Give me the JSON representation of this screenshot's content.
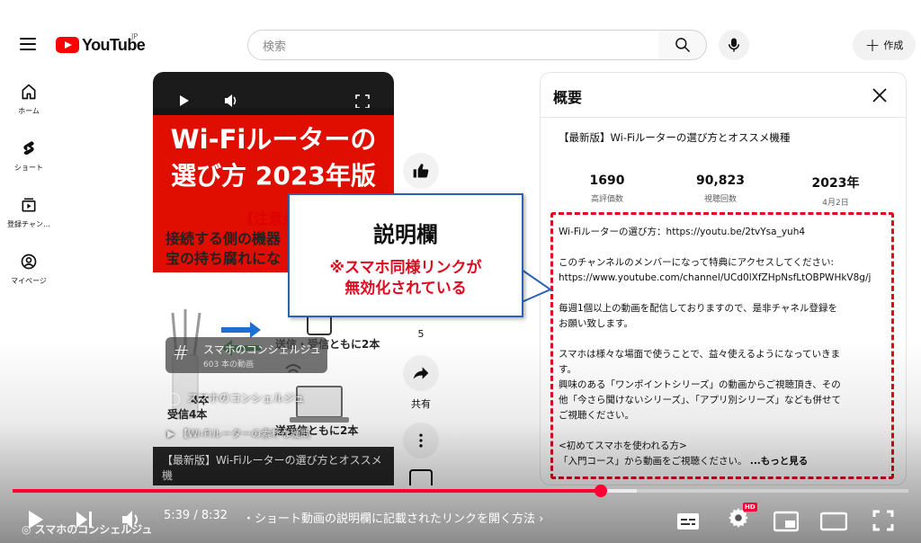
{
  "header": {
    "logo_text": "YouTube",
    "region": "JP",
    "search_placeholder": "検索",
    "create_label": "作成"
  },
  "nav": {
    "items": [
      {
        "label": "ホーム",
        "icon": "home-icon"
      },
      {
        "label": "ショート",
        "icon": "shorts-icon"
      },
      {
        "label": "登録チャン…",
        "icon": "subscriptions-icon"
      },
      {
        "label": "マイページ",
        "icon": "you-icon"
      }
    ]
  },
  "short": {
    "title_line1": "Wi-Fiルーターの",
    "title_line2": "選び方 2023年版",
    "caution": "【注意点",
    "body_line1": "接続する側の機器",
    "body_line2": "宝の持ち腐れにな",
    "diagram_label_top": "送信・受信ともに2本",
    "diagram_label_left1": "4本",
    "diagram_label_left2": "受信4本",
    "diagram_label_bottom": "送受信ともに2本",
    "channel_overlay": "スマホのコンシェルジュ",
    "overlay_link": "【Wi-Fiルーターの素朴な疑問",
    "bottom_title_line1": "【最新版】Wi-Fiルーターの選び方とオススメ機",
    "bottom_title_line2": "種"
  },
  "playlist_chip": {
    "title": "スマホのコンシェルジュ",
    "count": "603 本の動画"
  },
  "rail": {
    "like_count": "5",
    "share_label": "共有"
  },
  "description": {
    "header_title": "概要",
    "video_title": "【最新版】Wi-Fiルーターの選び方とオススメ機種",
    "stats": [
      {
        "value": "1690",
        "label": "高評価数"
      },
      {
        "value": "90,823",
        "label": "視聴回数"
      },
      {
        "value": "2023年",
        "label": "4月2日"
      }
    ],
    "paragraphs": [
      "Wi-Fiルーターの選び方：https://youtu.be/2tvYsa_yuh4",
      "このチャンネルのメンバーになって特典にアクセスしてください:",
      "https://www.youtube.com/channel/UCd0lXfZHpNsfLtOBPWHkV8g/j",
      "毎週1個以上の動画を配信しておりますので、是非チャネル登録を",
      "お願い致します。",
      "スマホは様々な場面で使うことで、益々使えるようになっていきま",
      "す。",
      "興味のある「ワンポイントシリーズ」の動画からご視聴頂き、その",
      "他「今さら聞けないシリーズ」、「アプリ別シリーズ」なども併せて",
      "ご視聴ください。",
      "<初めてスマホを使われる方>",
      "「入門コース」から動画をご視聴ください。"
    ],
    "more_label": "...もっと見る"
  },
  "callout": {
    "title": "説明欄",
    "line1": "※スマホ同様リンクが",
    "line2": "無効化されている"
  },
  "player": {
    "time": "5:39 / 8:32",
    "chapter": "・ショート動画の説明欄に記載されたリンクを開く方法",
    "progress": 0.657,
    "hd_badge": "HD",
    "watermark": "スマホのコンシェルジュ"
  },
  "colors": {
    "accent_red": "#ff0033",
    "callout_border": "#2a62b8",
    "dashed_red": "#e00a1e",
    "thumb_red": "#e00e00"
  }
}
